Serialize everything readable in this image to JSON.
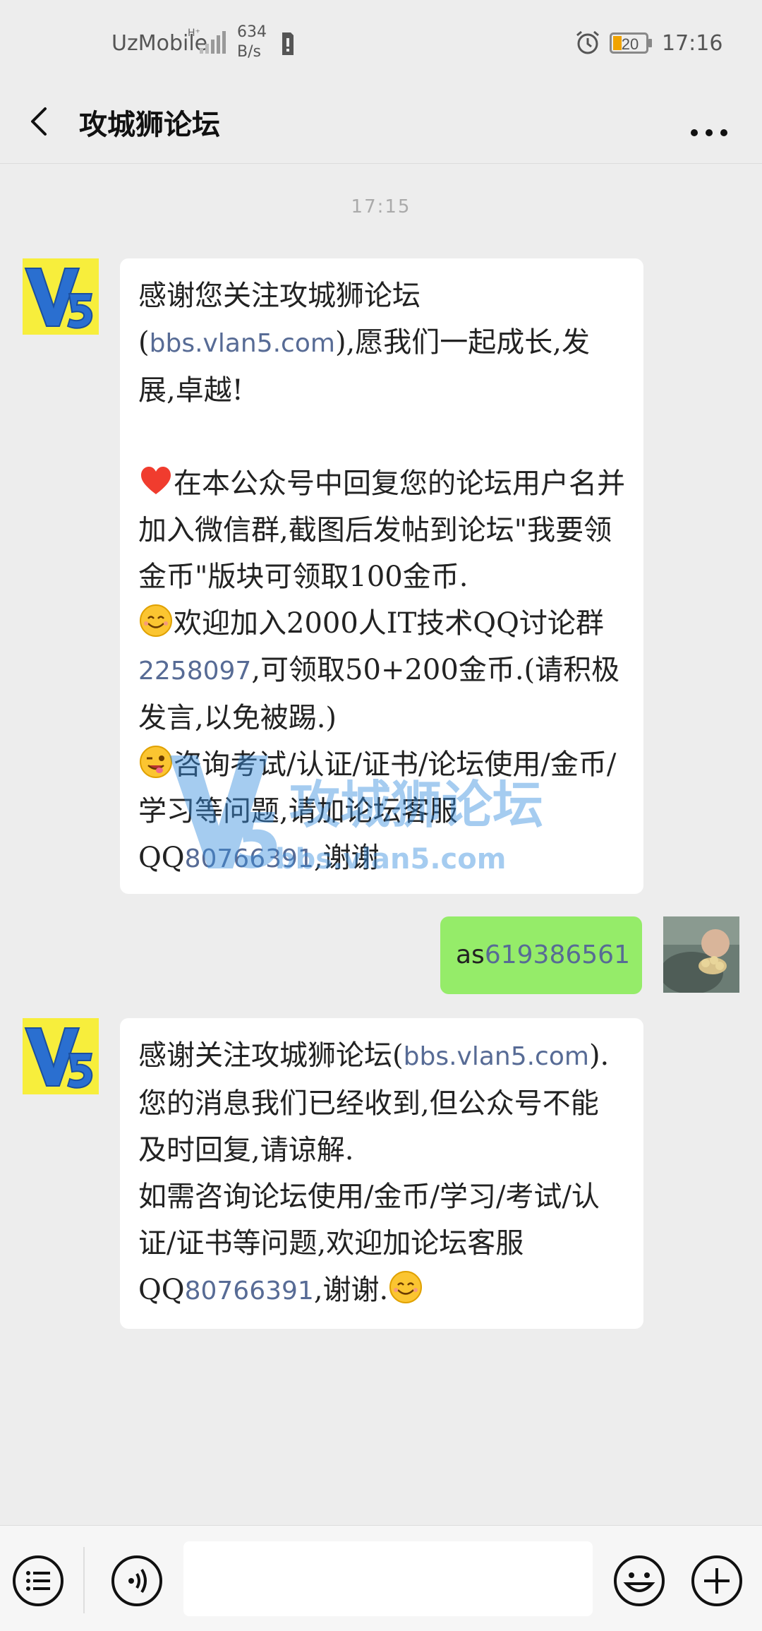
{
  "status": {
    "carrier": "UzMobile",
    "net_type": "H⁺",
    "speed_value": "634",
    "speed_unit": "B/s",
    "battery": "20",
    "time": "17:16"
  },
  "nav": {
    "title": "攻城狮论坛"
  },
  "chat": {
    "timestamp": "17:15",
    "messages": [
      {
        "p1a": "感谢您关注攻城狮论坛(",
        "p1link": "bbs.vlan5.com",
        "p1b": "),愿我们一起成长,发展,卓越!",
        "p2": "在本公众号中回复您的论坛用户名并加入微信群,截图后发帖到论坛\"我要领金币\"版块可领取100金币.",
        "p3a": "欢迎加入2000人IT技术QQ讨论群",
        "p3num": "2258097",
        "p3b": ",可领取50+200金币.(请积极发言,以免被踢.)",
        "p4a": "咨询考试/认证/证书/论坛使用/金币/学习等问题,请加论坛客服QQ",
        "p4num": "80766391",
        "p4b": ",谢谢"
      },
      {
        "prefix": "as",
        "num": "619386561"
      },
      {
        "l1a": "感谢关注攻城狮论坛(",
        "l1link": "bbs.vlan5.com",
        "l1b": ").您的消息我们已经收到,但公众号不能及时回复,请谅解.",
        "l2a": "如需咨询论坛使用/金币/学习/考试/认证/证书等问题,欢迎加论坛客服QQ",
        "l2num": "80766391",
        "l2b": ",谢谢."
      }
    ]
  },
  "watermark": {
    "title": "攻城狮论坛",
    "url": "bbs.vlan5.com"
  },
  "icons": {
    "menu": "list-icon",
    "voice": "voice-icon",
    "emoji": "emoji-icon",
    "add": "plus-icon"
  },
  "colors": {
    "link": "#576b95",
    "sent_bubble": "#95ec69",
    "avatar_bg": "#f7ee3c"
  }
}
